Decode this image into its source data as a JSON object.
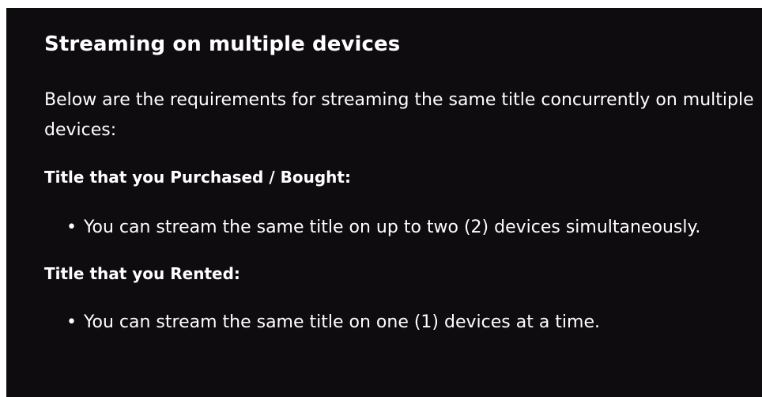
{
  "article": {
    "title": "Streaming on multiple devices",
    "intro": "Below are the requirements for streaming the same title concurrently on multiple devices:",
    "sections": [
      {
        "heading": "Title that you Purchased / Bought:",
        "bullets": [
          "You can stream the same title on up to two (2) devices simultaneously."
        ]
      },
      {
        "heading": "Title that you Rented:",
        "bullets": [
          "You can stream the same title on one (1) devices at a time."
        ]
      }
    ],
    "bullet_glyph": "•"
  },
  "colors": {
    "background": "#0f0c10",
    "text": "#ffffff"
  }
}
